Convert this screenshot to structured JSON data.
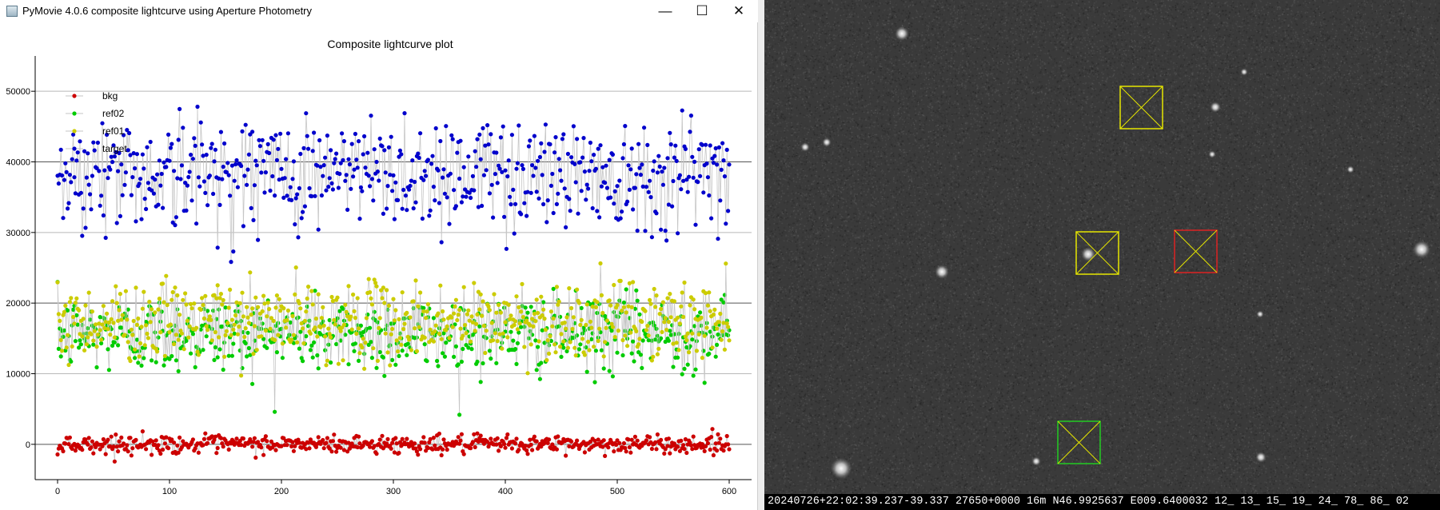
{
  "window": {
    "title": "PyMovie 4.0.6 composite lightcurve using Aperture Photometry",
    "min_glyph": "—",
    "max_glyph": "☐",
    "close_glyph": "✕",
    "icon": "app-icon"
  },
  "chart_data": {
    "type": "scatter",
    "title": "Composite lightcurve plot",
    "xlim": [
      -20,
      620
    ],
    "ylim": [
      -5000,
      55000
    ],
    "xticks": [
      0,
      100,
      200,
      300,
      400,
      500,
      600
    ],
    "yticks": [
      0,
      10000,
      20000,
      30000,
      40000,
      50000
    ],
    "grid_y": true,
    "legend_position": "top-left",
    "n_points": 601,
    "series": [
      {
        "name": "bkg",
        "color": "#cc0000",
        "mean": 0,
        "spread": 700
      },
      {
        "name": "ref02",
        "color": "#00cc00",
        "mean": 15500,
        "spread": 3000
      },
      {
        "name": "ref01",
        "color": "#cccc00",
        "mean": 17500,
        "spread": 3000
      },
      {
        "name": "target",
        "color": "#0000cc",
        "mean": 38500,
        "spread": 4500
      }
    ]
  },
  "image": {
    "timestamp": "20240726+22:02:39.237-39.337 27650+0000   16m N46.9925637 E009.6400032 12_ 13_ 15_ 19_ 24_ 78_ 86_ 02",
    "apertures": [
      {
        "color": "#e6e600",
        "label": "yellow"
      },
      {
        "color": "#e6e600",
        "label": "yellow"
      },
      {
        "color": "#dd2222",
        "label": "red"
      },
      {
        "color": "#22cc22",
        "label": "green"
      }
    ]
  }
}
